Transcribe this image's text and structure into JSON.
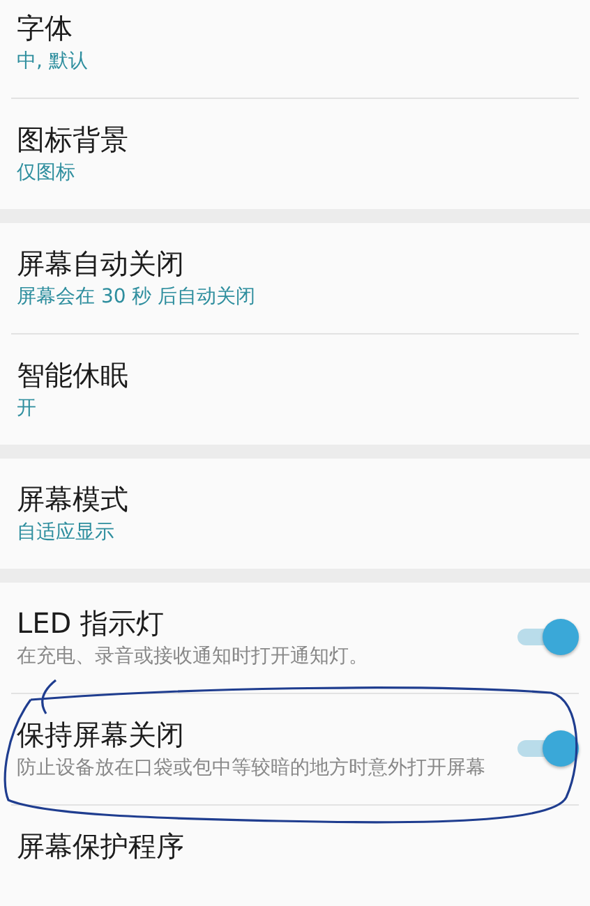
{
  "groups": [
    {
      "items": [
        {
          "kind": "text",
          "title": "字体",
          "subtitle": "中, 默认"
        },
        {
          "kind": "text",
          "title": "图标背景",
          "subtitle": "仅图标"
        }
      ]
    },
    {
      "items": [
        {
          "kind": "text",
          "title": "屏幕自动关闭",
          "subtitle": "屏幕会在 30 秒 后自动关闭"
        },
        {
          "kind": "text",
          "title": "智能休眠",
          "subtitle": "开"
        }
      ]
    },
    {
      "items": [
        {
          "kind": "text",
          "title": "屏幕模式",
          "subtitle": "自适应显示"
        }
      ]
    },
    {
      "items": [
        {
          "kind": "toggle",
          "title": "LED 指示灯",
          "subtitle": "在充电、录音或接收通知时打开通知灯。",
          "on": true
        },
        {
          "kind": "toggle",
          "title": "保持屏幕关闭",
          "subtitle": "防止设备放在口袋或包中等较暗的地方时意外打开屏幕",
          "on": true
        },
        {
          "kind": "text",
          "title": "屏幕保护程序"
        }
      ]
    }
  ]
}
